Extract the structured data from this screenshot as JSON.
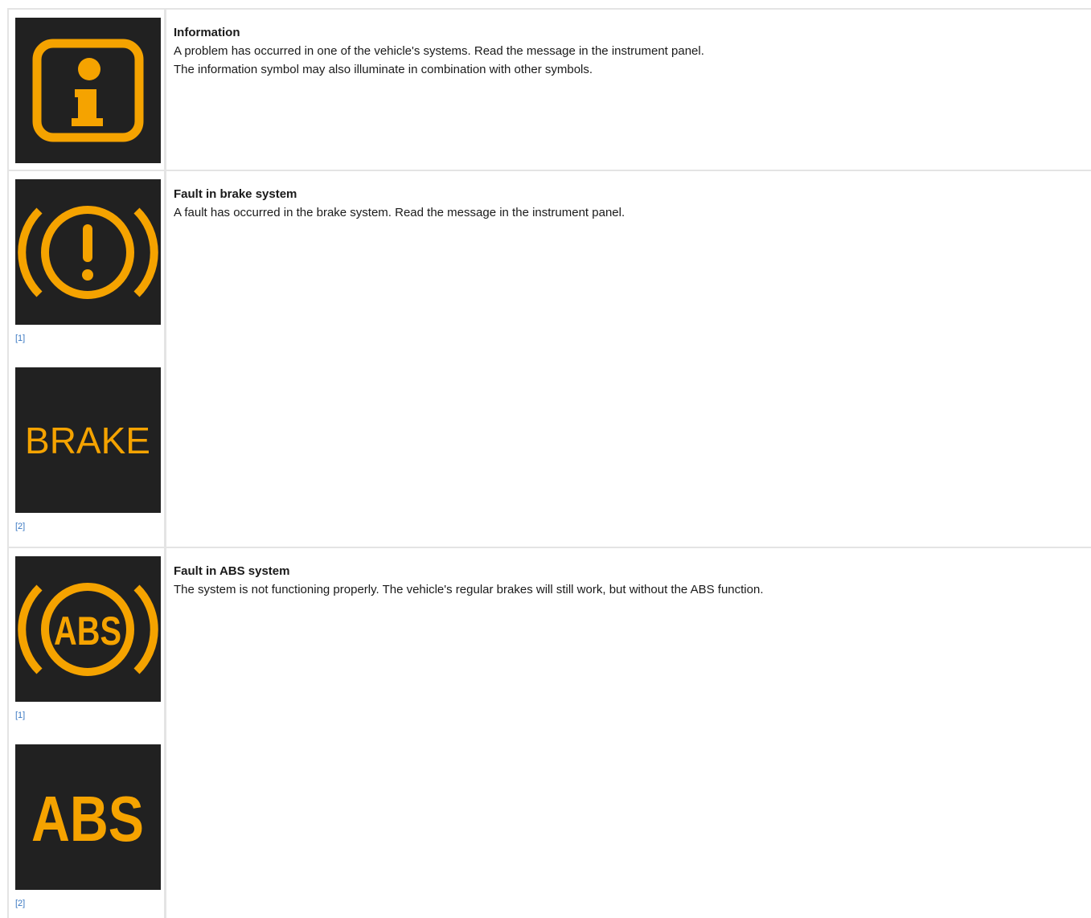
{
  "colors": {
    "accent": "#F5A300",
    "icon_background": "#212121",
    "link": "#3A78C2",
    "border": "#E4E4E4"
  },
  "rows": [
    {
      "icons": [
        {
          "name": "information-symbol-icon",
          "ref": ""
        }
      ],
      "title": "Information",
      "paragraphs": [
        "A problem has occurred in one of the vehicle's systems. Read the message in the instrument panel.",
        "The information symbol may also illuminate in combination with other symbols."
      ]
    },
    {
      "icons": [
        {
          "name": "brake-warning-circle-icon",
          "ref": "[1]"
        },
        {
          "name": "brake-text-icon",
          "text": "BRAKE",
          "ref": "[2]"
        }
      ],
      "title": "Fault in brake system",
      "paragraphs": [
        "A fault has occurred in the brake system. Read the message in the instrument panel."
      ]
    },
    {
      "icons": [
        {
          "name": "abs-circle-icon",
          "text": "ABS",
          "ref": "[1]"
        },
        {
          "name": "abs-text-icon",
          "text": "ABS",
          "ref": "[2]"
        }
      ],
      "title": "Fault in ABS system",
      "paragraphs": [
        "The system is not functioning properly. The vehicle's regular brakes will still work, but without the ABS function."
      ]
    }
  ]
}
